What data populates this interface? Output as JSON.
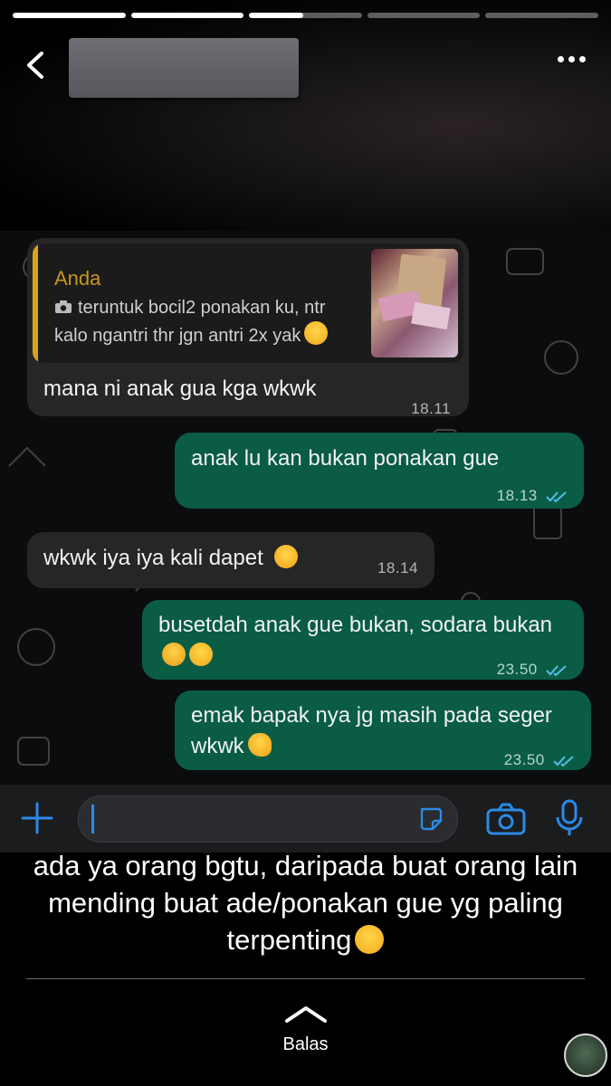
{
  "story": {
    "progress": [
      1,
      1,
      0.48,
      0,
      0
    ]
  },
  "chat": {
    "quoted": {
      "author": "Anda",
      "text": "teruntuk bocil2 ponakan ku, ntr kalo ngantri thr jgn antri 2x yak"
    },
    "messages": [
      {
        "dir": "in",
        "text": "mana ni anak gua kga wkwk",
        "time": "18.11"
      },
      {
        "dir": "out",
        "text": "anak lu kan bukan ponakan gue",
        "time": "18.13"
      },
      {
        "dir": "in",
        "text": "wkwk iya iya kali dapet",
        "time": "18.14"
      },
      {
        "dir": "out",
        "text": "busetdah anak gue bukan, sodara bukan",
        "time": "23.50"
      },
      {
        "dir": "out",
        "text": "emak bapak nya jg masih pada seger wkwk",
        "time": "23.50"
      }
    ]
  },
  "composer": {
    "icons": [
      "plus-icon",
      "sticker-icon",
      "camera-icon",
      "microphone-icon"
    ]
  },
  "caption": {
    "text": "ada ya orang bgtu, daripada buat orang lain mending buat ade/ponakan gue yg paling terpenting"
  },
  "reply": {
    "label": "Balas"
  },
  "colors": {
    "outgoing_bubble": "#0a5c45",
    "incoming_bubble": "#262626",
    "quote_accent": "#d9a31a",
    "ticks": "#53bdeb"
  }
}
